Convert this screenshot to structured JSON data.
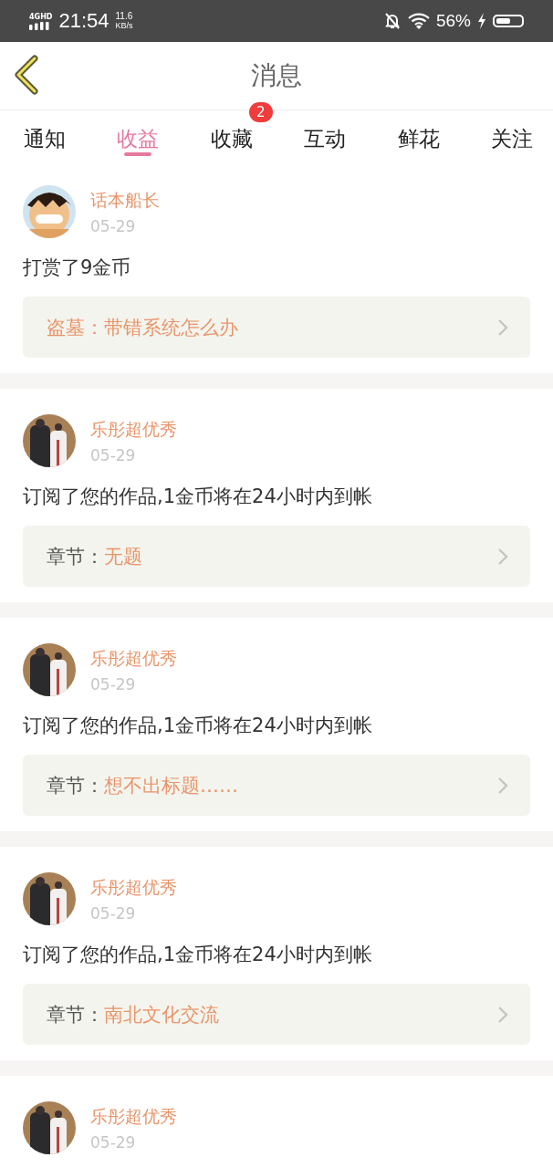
{
  "status_bar": {
    "network": "4GHD",
    "time": "21:54",
    "speed_value": "11.6",
    "speed_unit": "KB/s",
    "battery": "56%"
  },
  "header": {
    "title": "消息"
  },
  "tabs": [
    {
      "label": "通知",
      "selected": false
    },
    {
      "label": "收益",
      "selected": true
    },
    {
      "label": "收藏",
      "selected": false,
      "badge": "2"
    },
    {
      "label": "互动",
      "selected": false
    },
    {
      "label": "鲜花",
      "selected": false
    },
    {
      "label": "关注",
      "selected": false
    }
  ],
  "messages": [
    {
      "user": "话本船长",
      "date": "05-29",
      "text": "打赏了9金币",
      "link": {
        "prefix": "盗墓：",
        "title": "带错系统怎么办",
        "prefix_accent": true
      }
    },
    {
      "user": "乐彤超优秀",
      "date": "05-29",
      "text": "订阅了您的作品,1金币将在24小时内到帐",
      "link": {
        "prefix": "章节：",
        "title": "无题",
        "prefix_accent": false
      }
    },
    {
      "user": "乐彤超优秀",
      "date": "05-29",
      "text": "订阅了您的作品,1金币将在24小时内到帐",
      "link": {
        "prefix": "章节：",
        "title": "想不出标题……",
        "prefix_accent": false
      }
    },
    {
      "user": "乐彤超优秀",
      "date": "05-29",
      "text": "订阅了您的作品,1金币将在24小时内到帐",
      "link": {
        "prefix": "章节：",
        "title": "南北文化交流",
        "prefix_accent": false
      }
    },
    {
      "user": "乐彤超优秀",
      "date": "05-29"
    }
  ]
}
